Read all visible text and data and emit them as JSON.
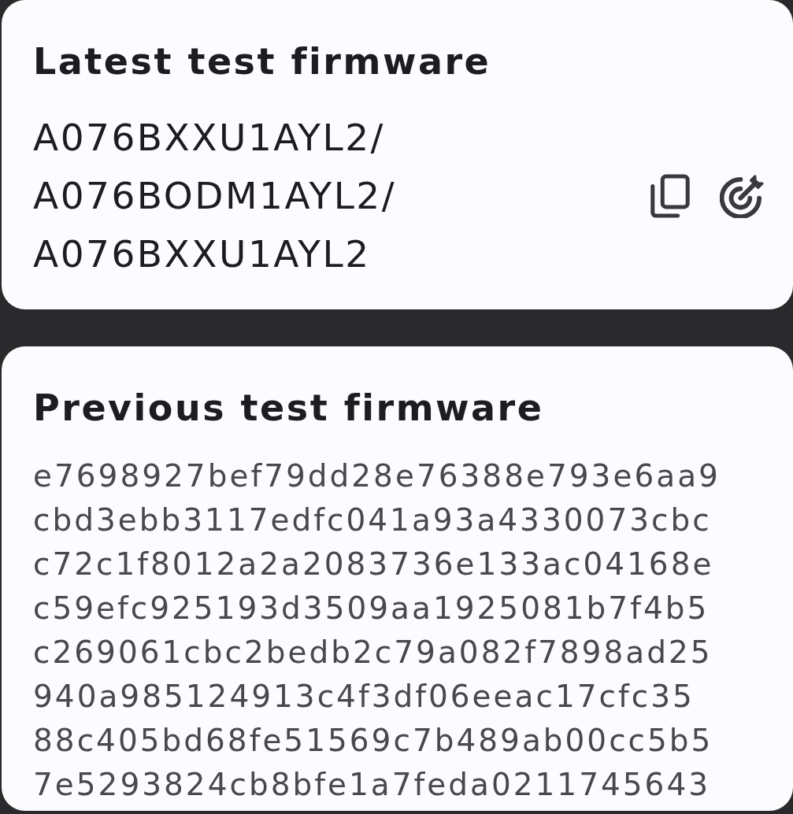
{
  "cards": [
    {
      "kind": "version",
      "title": "Latest test firmware",
      "lines": [
        "A076BXXU1AYL2/",
        "A076BODM1AYL2/",
        "A076BXXU1AYL2"
      ]
    },
    {
      "kind": "hashes",
      "title": "Previous test firmware",
      "lines": [
        "e7698927bef79dd28e76388e793e6aa9",
        "cbd3ebb3117edfc041a93a4330073cbc",
        "c72c1f8012a2a2083736e133ac04168e",
        "c59efc925193d3509aa1925081b7f4b5",
        "c269061cbc2bedb2c79a082f7898ad25",
        "940a985124913c4f3df06eeac17cfc35",
        "88c405bd68fe51569c7b489ab00cc5b5",
        "7e5293824cb8bfe1a7feda0211745643"
      ]
    }
  ]
}
